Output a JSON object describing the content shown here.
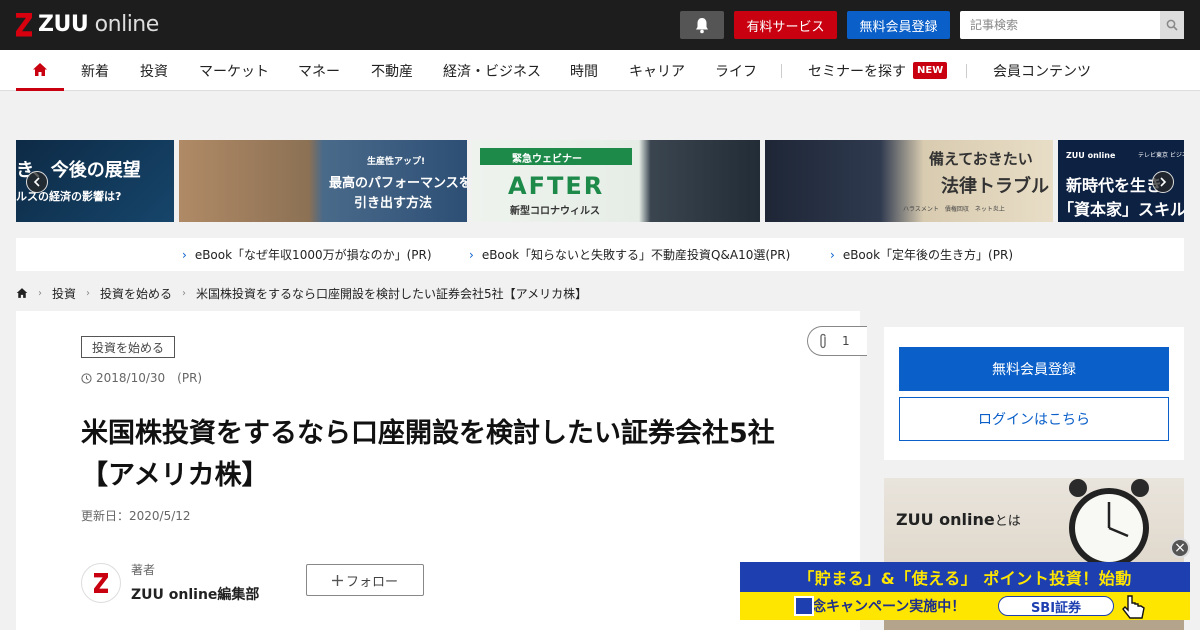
{
  "header": {
    "logo_main": "ZUU",
    "logo_sub": " online",
    "paid_service": "有料サービス",
    "free_register": "無料会員登録",
    "search_placeholder": "記事検索"
  },
  "nav": {
    "items": [
      "新着",
      "投資",
      "マーケット",
      "マネー",
      "不動産",
      "経済・ビジネス",
      "時間",
      "キャリア",
      "ライフ"
    ],
    "seminar": "セミナーを探す",
    "new_badge": "NEW",
    "members": "会員コンテンツ"
  },
  "carousel": {
    "slides": [
      {
        "text1": "き、今後の展望",
        "text2": "ルスの経済の影響は?"
      },
      {
        "text1": "生産性アップ!",
        "text2": "最高のパフォーマンスを",
        "text3": "引き出す方法"
      },
      {
        "text1": "緊急ウェビナー",
        "text2": "AFTER",
        "text3": "新型コロナウィルス"
      },
      {
        "text1": "備えておきたい",
        "text2": "法律トラブル",
        "text3": "ハラスメント　債権回収　ネット炎上"
      },
      {
        "text1": "ZUU online",
        "text2": "テレビ東京 ビジネスオン",
        "text3": "新時代を生き",
        "text4": "「資本家」スキル"
      }
    ]
  },
  "ebooks": [
    "eBook「なぜ年収1000万が損なのか」(PR)",
    "eBook「知らないと失敗する」不動産投資Q&A10選(PR)",
    "eBook「定年後の生き方」(PR)"
  ],
  "breadcrumb": [
    "投資",
    "投資を始める",
    "米国株投資をするなら口座開設を検討したい証券会社5社【アメリカ株】"
  ],
  "article": {
    "category": "投資を始める",
    "clip_count": "1",
    "date": "2018/10/30",
    "pr": "(PR)",
    "title": "米国株投資をするなら口座開設を検討したい証券会社5社【アメリカ株】",
    "updated": "更新日：2020/5/12",
    "author_label": "著者",
    "author_name": "ZUU online編集部",
    "follow": "フォロー"
  },
  "sidebar": {
    "register": "無料会員登録",
    "login": "ログインはこちら",
    "about_title": "ZUU online",
    "about_suffix": "とは"
  },
  "ad": {
    "line1": "「貯まる」&「使える」 ポイント投資！始動",
    "line2": "記念キャンペーン実施中！",
    "logo": "SBI証券"
  },
  "colors": {
    "brand_red": "#c8000f",
    "brand_blue": "#0a5fc9",
    "topbar": "#1d1d1d"
  }
}
